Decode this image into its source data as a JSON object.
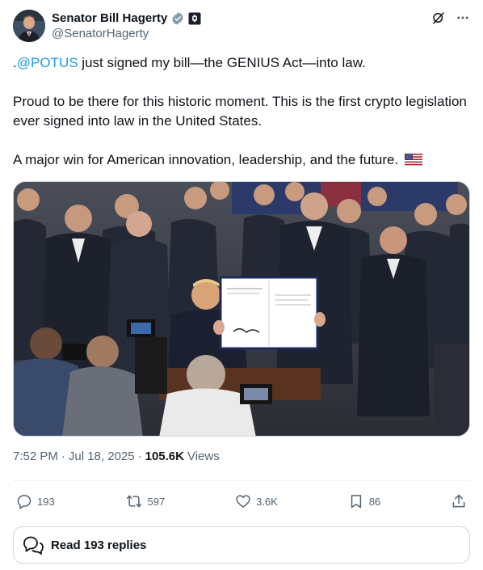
{
  "author": {
    "display_name": "Senator Bill Hagerty",
    "handle": "@SenatorHagerty",
    "verified_color": "#829aab"
  },
  "tweet": {
    "mention": "@POTUS",
    "line1_prefix": ".",
    "line1_rest": " just signed my bill—the GENIUS Act—into law.",
    "para2": "Proud to be there for this historic moment. This is the first crypto legislation ever signed into law in the United States.",
    "para3": "A major win for American innovation, leadership, and the future.",
    "flag": "US flag emoji"
  },
  "meta": {
    "time": "7:52 PM",
    "separator": "·",
    "date": "Jul 18, 2025",
    "views_count": "105.6K",
    "views_label": "Views"
  },
  "actions": {
    "replies": "193",
    "reposts": "597",
    "likes": "3.6K",
    "bookmarks": "86"
  },
  "read_replies": "Read 193 replies",
  "colors": {
    "link": "#1d9bf0",
    "text": "#0f1419",
    "secondary": "#536471",
    "border": "#cfd9de"
  }
}
